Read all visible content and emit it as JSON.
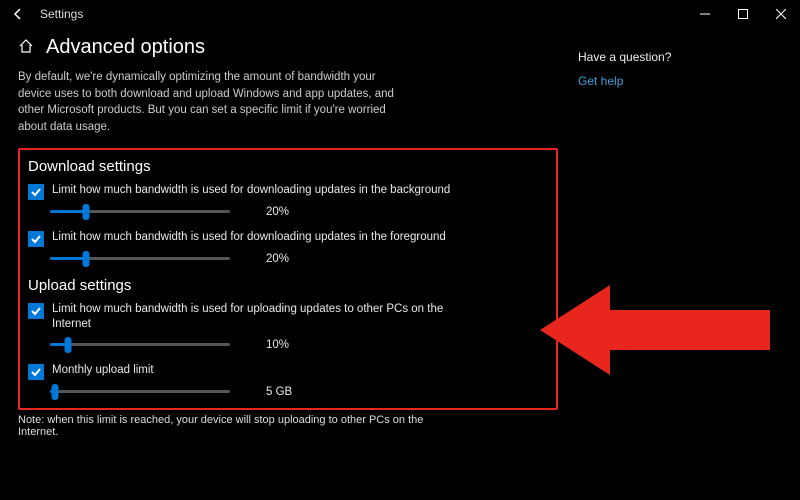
{
  "window": {
    "title": "Settings"
  },
  "page": {
    "heading": "Advanced options",
    "description": "By default, we're dynamically optimizing the amount of bandwidth your device uses to both download and upload Windows and app updates, and other Microsoft products. But you can set a specific limit if you're worried about data usage."
  },
  "download": {
    "section_title": "Download settings",
    "opt1": {
      "label": "Limit how much bandwidth is used for downloading updates in the background",
      "checked": true,
      "value_pct": 20,
      "value_text": "20%"
    },
    "opt2": {
      "label": "Limit how much bandwidth is used for downloading updates in the foreground",
      "checked": true,
      "value_pct": 20,
      "value_text": "20%"
    }
  },
  "upload": {
    "section_title": "Upload settings",
    "opt1": {
      "label": "Limit how much bandwidth is used for uploading updates to other PCs on the Internet",
      "checked": true,
      "value_pct": 10,
      "value_text": "10%"
    },
    "opt2": {
      "label": "Monthly upload limit",
      "checked": true,
      "value_pct": 3,
      "value_text": "5 GB"
    }
  },
  "note": "Note: when this limit is reached, your device will stop uploading to other PCs on the Internet.",
  "help": {
    "question": "Have a question?",
    "link": "Get help"
  },
  "annotation": {
    "arrow_color": "#e8261d"
  }
}
